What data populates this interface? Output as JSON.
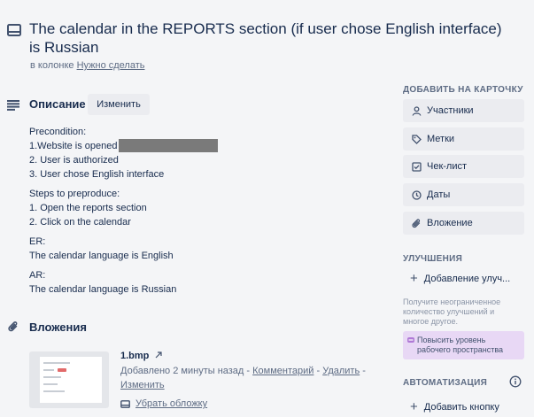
{
  "card": {
    "title": "The calendar in the REPORTS section (if user chose English interface) is Russian",
    "in_list_prefix": "в колонке",
    "list_name": "Нужно сделать"
  },
  "description": {
    "heading": "Описание",
    "edit_label": "Изменить",
    "precondition_label": "Precondition:",
    "precondition_items": [
      "1.Website is opened",
      "2. User is authorized",
      "3. User chose English interface"
    ],
    "steps_label": "Steps to preproduce:",
    "steps_items": [
      "1. Open the reports section",
      "2. Click on the calendar"
    ],
    "er_label": "ER:",
    "er_text": "The calendar language is English",
    "ar_label": "AR:",
    "ar_text": "The calendar language is Russian"
  },
  "attachments": {
    "heading": "Вложения",
    "file_name": "1.bmp",
    "added_text": "Добавлено 2 минуты назад",
    "comment_link": "Комментарий",
    "delete_link": "Удалить",
    "edit_link": "Изменить",
    "remove_cover": "Убрать обложку"
  },
  "sidebar": {
    "add_to_card_heading": "ДОБАВИТЬ НА КАРТОЧКУ",
    "buttons": [
      "Участники",
      "Метки",
      "Чек-лист",
      "Даты",
      "Вложение"
    ],
    "powerups_heading": "УЛУЧШЕНИЯ",
    "add_powerup": "Добавление улуч...",
    "upsell_text": "Получите неограниченное количество улучшений и многое другое.",
    "upgrade_label": "Повысить уровень рабочего пространства",
    "automation_heading": "АВТОМАТИЗАЦИЯ",
    "add_button": "Добавить кнопку"
  },
  "colors": {
    "background": "#f4f5f7",
    "button_bg": "#ebecf0",
    "upgrade_bg": "#e8d8f5",
    "text": "#172b4d",
    "muted": "#5e6c84"
  }
}
